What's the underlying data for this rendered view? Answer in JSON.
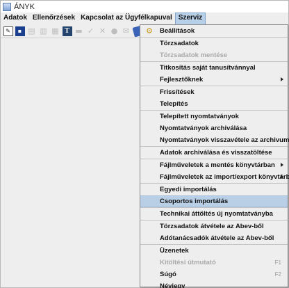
{
  "window": {
    "title": "ÁNYK"
  },
  "menubar": {
    "items": [
      {
        "label": "Adatok"
      },
      {
        "label": "Ellenőrzések"
      },
      {
        "label": "Kapcsolat az Ügyfélkapuval"
      },
      {
        "label": "Szerviz"
      }
    ]
  },
  "toolbar": {
    "icons": [
      "new-document-icon",
      "save-icon",
      "open-icon",
      "check-icon",
      "print-preview-icon",
      "book-icon",
      "printer-icon",
      "checkmark-icon",
      "delete-icon",
      "help-icon",
      "mail-icon",
      "upload-icon"
    ]
  },
  "colors": {
    "menu_highlight": "#b8cfe5",
    "disabled_text": "#a9a9a9"
  },
  "szerviz_menu": [
    {
      "label": "Beállítások",
      "icon": "settings-wrench-icon"
    },
    {
      "label": "Törzsadatok"
    },
    {
      "label": "Törzsadatok mentése",
      "disabled": true
    },
    {
      "label": "Titkosítás saját tanusítvánnyal"
    },
    {
      "label": "Fejlesztőknek",
      "submenu": true
    },
    {
      "label": "Frissítések"
    },
    {
      "label": "Telepítés"
    },
    {
      "label": "Telepített nyomtatványok"
    },
    {
      "label": "Nyomtatványok archiválása"
    },
    {
      "label": "Nyomtatványok visszavétele az archivumból"
    },
    {
      "label": "Adatok archiválása és visszatöltése"
    },
    {
      "label": "Fájlműveletek a mentés könyvtárban",
      "submenu": true
    },
    {
      "label": "Fájlműveletek az import/export könyvtárban",
      "submenu": true
    },
    {
      "label": "Egyedi importálás"
    },
    {
      "label": "Csoportos importálás",
      "highlighted": true
    },
    {
      "label": "Technikai áttöltés új nyomtatványba"
    },
    {
      "label": "Törzsadatok átvétele az Abev-ből"
    },
    {
      "label": "Adótanácsadók átvétele az Abev-ből"
    },
    {
      "label": "Üzenetek"
    },
    {
      "label": "Kitöltési útmutató",
      "disabled": true,
      "accelerator": "F1"
    },
    {
      "label": "Súgó",
      "accelerator": "F2"
    },
    {
      "label": "Névjegy"
    }
  ]
}
